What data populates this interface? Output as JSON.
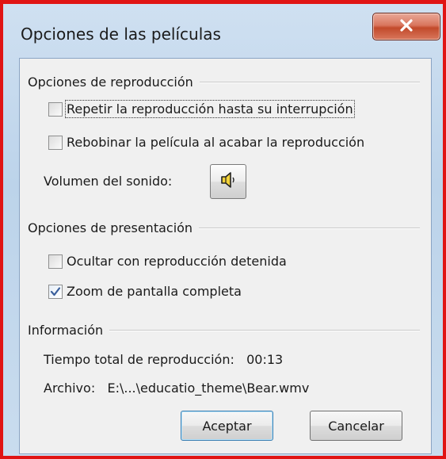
{
  "window": {
    "title": "Opciones de las películas",
    "close_icon": "close-x-icon"
  },
  "playback_group": {
    "label": "Opciones de reproducción",
    "loop": {
      "label": "Repetir la reproducción hasta su interrupción",
      "checked": false
    },
    "rewind": {
      "label": "Rebobinar la película al acabar la reproducción",
      "checked": false
    },
    "volume_label": "Volumen del sonido:",
    "volume_icon": "speaker-icon"
  },
  "display_group": {
    "label": "Opciones de presentación",
    "hide": {
      "label": "Ocultar con reproducción detenida",
      "checked": false
    },
    "zoom": {
      "label": "Zoom de pantalla completa",
      "checked": true
    }
  },
  "info_group": {
    "label": "Información",
    "total_time": "Tiempo total de reproducción:   00:13",
    "file": "Archivo:   E:\\...\\educatio_theme\\Bear.wmv"
  },
  "buttons": {
    "ok": "Aceptar",
    "cancel": "Cancelar"
  },
  "colors": {
    "frame_highlight": "#e01414",
    "close_button": "#c94a2e",
    "default_button_border": "#3c7fb1"
  }
}
